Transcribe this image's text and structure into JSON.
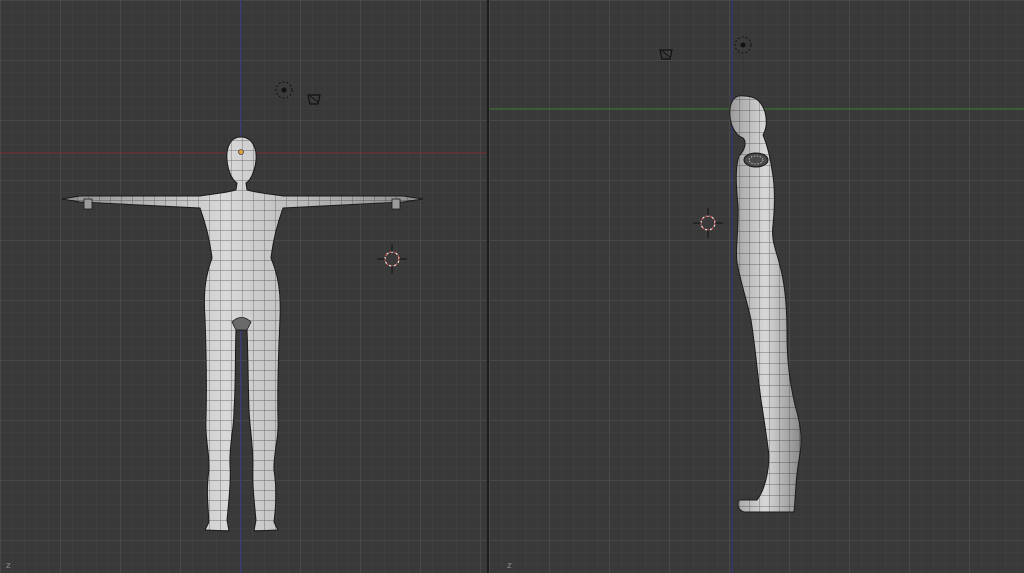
{
  "colors": {
    "background": "#393939",
    "grid": "#505050",
    "x_axis": "#7a2f2f",
    "y_axis": "#3b7a2f",
    "z_axis": "#34348a",
    "mesh_fill": "#bdbdbd",
    "mesh_wire": "#1a1a1a",
    "cursor_red": "#d9574f"
  },
  "viewports": {
    "front": {
      "view": "front",
      "corner_axis_glyph": "z"
    },
    "side": {
      "view": "right",
      "corner_axis_glyph": "z"
    }
  },
  "icons": [
    "camera-icon",
    "lamp-icon",
    "3d-cursor-icon",
    "mesh-figure-icon"
  ]
}
